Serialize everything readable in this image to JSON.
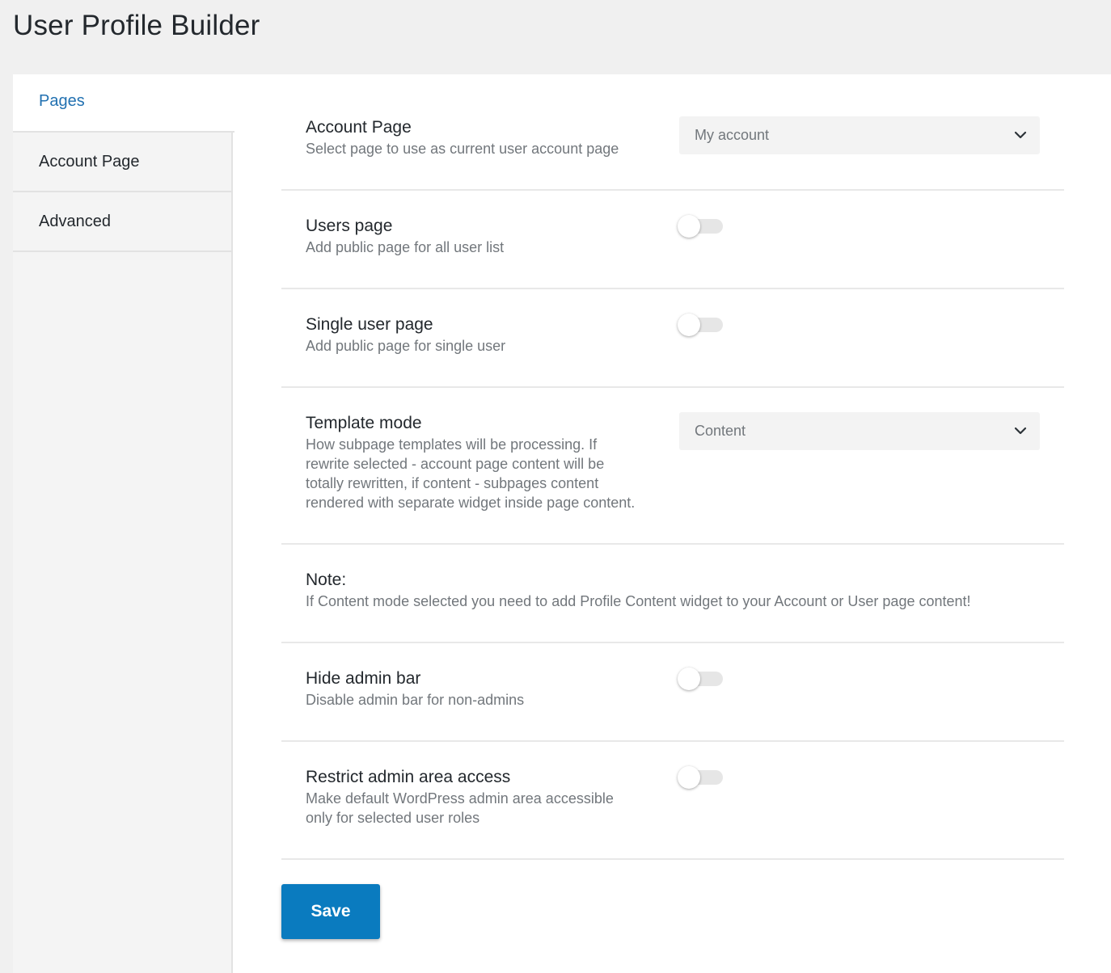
{
  "header": {
    "title": "User Profile Builder"
  },
  "sidebar": {
    "items": [
      {
        "label": "Pages",
        "active": true
      },
      {
        "label": "Account Page",
        "active": false
      },
      {
        "label": "Advanced",
        "active": false
      }
    ]
  },
  "settings": {
    "account_page": {
      "title": "Account Page",
      "description": "Select page to use as current user account page",
      "selected": "My account"
    },
    "users_page": {
      "title": "Users page",
      "description": "Add public page for all user list",
      "enabled": false
    },
    "single_user_page": {
      "title": "Single user page",
      "description": "Add public page for single user",
      "enabled": false
    },
    "template_mode": {
      "title": "Template mode",
      "description_lines": [
        "How subpage templates will be processing. If",
        "rewrite selected - account page content will be",
        "totally rewritten, if content - subpages content",
        "rendered with separate widget inside page content."
      ],
      "selected": "Content"
    },
    "note": {
      "title": "Note:",
      "text": "If Content mode selected you need to add Profile Content widget to your Account or User page content!"
    },
    "hide_admin_bar": {
      "title": "Hide admin bar",
      "description": "Disable admin bar for non-admins",
      "enabled": false
    },
    "restrict_admin": {
      "title": "Restrict admin area access",
      "description_lines": [
        "Make default WordPress admin area accessible",
        "only for selected user roles"
      ],
      "enabled": false
    }
  },
  "actions": {
    "save_label": "Save"
  },
  "icons": {
    "select_arrow": "chevron-down-icon"
  },
  "colors": {
    "accent": "#2271b1",
    "button": "#0a7bbf"
  }
}
